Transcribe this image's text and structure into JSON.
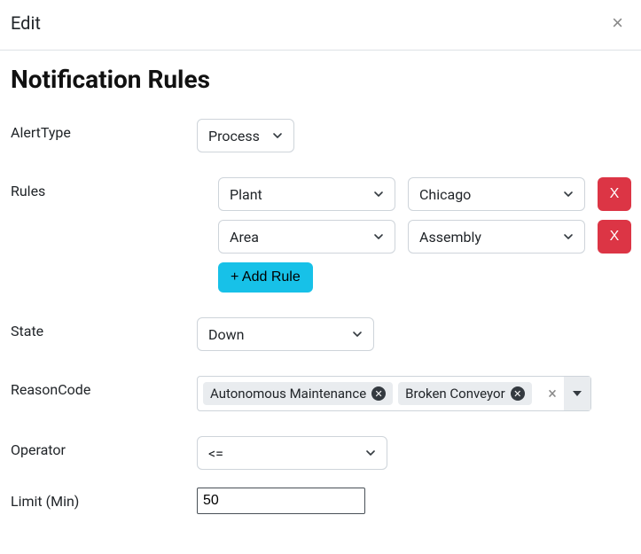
{
  "header": {
    "title": "Edit"
  },
  "page": {
    "title": "Notification Rules"
  },
  "labels": {
    "alertType": "AlertType",
    "rules": "Rules",
    "state": "State",
    "reasonCode": "ReasonCode",
    "operator": "Operator",
    "limit": "Limit (Min)"
  },
  "alertType": {
    "value": "Process"
  },
  "rules": [
    {
      "scope": "Plant",
      "value": "Chicago"
    },
    {
      "scope": "Area",
      "value": "Assembly"
    }
  ],
  "buttons": {
    "addRule": "+ Add Rule",
    "deleteRule": "X"
  },
  "state": {
    "value": "Down"
  },
  "reasonCodes": [
    "Autonomous Maintenance",
    "Broken Conveyor"
  ],
  "operator": {
    "value": "<="
  },
  "limit": {
    "value": "50"
  },
  "icons": {
    "close": "close-icon",
    "chevron": "chevron-down-icon",
    "clear": "clear-icon",
    "tagRemove": "tag-remove-icon",
    "dropdownCaret": "dropdown-caret-icon"
  }
}
